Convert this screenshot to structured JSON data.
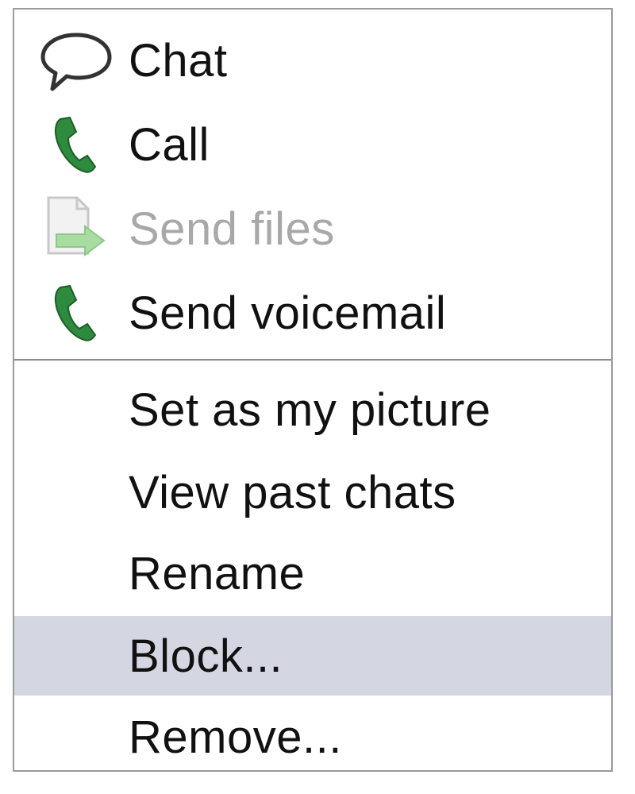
{
  "context_menu": {
    "items": [
      {
        "label": "Chat",
        "icon": "chat-bubble-icon",
        "enabled": true
      },
      {
        "label": "Call",
        "icon": "phone-icon",
        "enabled": true
      },
      {
        "label": "Send files",
        "icon": "send-file-icon",
        "enabled": false
      },
      {
        "label": "Send voicemail",
        "icon": "phone-icon",
        "enabled": true
      },
      {
        "label": "Set as my picture",
        "enabled": true
      },
      {
        "label": "View past chats",
        "enabled": true
      },
      {
        "label": "Rename",
        "enabled": true
      },
      {
        "label": "Block...",
        "enabled": true,
        "highlighted": true
      },
      {
        "label": "Remove...",
        "enabled": true
      }
    ]
  },
  "colors": {
    "highlight": "#d4d6e1",
    "phone_icon": "#2e8b3e",
    "disabled_text": "#a8a8a8",
    "border": "#9a9a9a"
  }
}
